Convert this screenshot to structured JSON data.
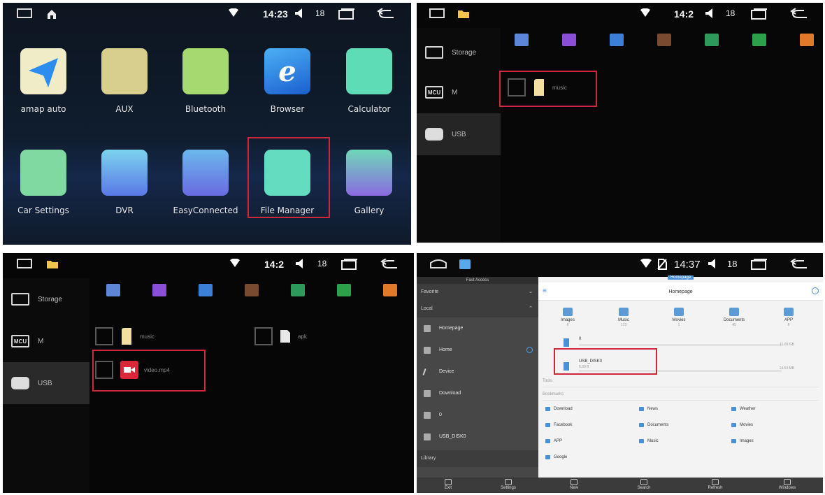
{
  "panel1": {
    "status": {
      "time": "14:23",
      "volume": "18"
    },
    "apps_row1": [
      {
        "label": "amap auto",
        "color": "#f0ecc8"
      },
      {
        "label": "AUX",
        "color": "#d8cf8e"
      },
      {
        "label": "Bluetooth",
        "color": "#a6d970"
      },
      {
        "label": "Browser",
        "color": "#2d7fd8"
      },
      {
        "label": "Calculator",
        "color": "#5ddcb6"
      }
    ],
    "apps_row2": [
      {
        "label": "Car Settings",
        "color": "#7fd9a0"
      },
      {
        "label": "DVR",
        "color": "#6fc1e8"
      },
      {
        "label": "EasyConnected",
        "color": "#5fa4e8"
      },
      {
        "label": "File Manager",
        "color": "#64dcc0"
      },
      {
        "label": "Gallery",
        "color": "#6fd8b8"
      }
    ]
  },
  "panel2": {
    "status": {
      "time": "14:2",
      "volume": "18"
    },
    "sidebar": [
      {
        "icon_label": "",
        "label": "Storage"
      },
      {
        "icon_label": "MCU",
        "label": "M"
      },
      {
        "icon_label": "",
        "label": "USB"
      }
    ],
    "categories": [
      {
        "name": "grid-icon",
        "color": "#5d86d8"
      },
      {
        "name": "image-icon",
        "color": "#8a4fd6"
      },
      {
        "name": "music-icon",
        "color": "#3c7fd6"
      },
      {
        "name": "video-icon",
        "color": "#7a4a2f"
      },
      {
        "name": "apk-icon",
        "color": "#2e9a5a"
      },
      {
        "name": "doc-icon",
        "color": "#2da04a"
      },
      {
        "name": "zip-icon",
        "color": "#e07a2a"
      }
    ],
    "file": "music"
  },
  "panel3": {
    "status": {
      "time": "14:2",
      "volume": "18"
    },
    "sidebar": [
      {
        "icon_label": "",
        "label": "Storage"
      },
      {
        "icon_label": "MCU",
        "label": "M"
      },
      {
        "icon_label": "",
        "label": "USB"
      }
    ],
    "files": [
      "music",
      "video.mp4",
      "apk"
    ]
  },
  "panel4": {
    "status": {
      "time": "14:37",
      "volume": "18"
    },
    "left_header": "Fast Access",
    "favorite": "Favorite",
    "local": "Local",
    "local_items": [
      "Homepage",
      "Home",
      "Device",
      "Download",
      "0",
      "USB_DISK0"
    ],
    "library": "Library",
    "tab": "Homepage",
    "title": "Homepage",
    "quick": [
      {
        "label": "Images",
        "count": "6"
      },
      {
        "label": "Music",
        "count": "173"
      },
      {
        "label": "Movies",
        "count": "1"
      },
      {
        "label": "Documents",
        "count": "45"
      },
      {
        "label": "APP",
        "count": "8"
      }
    ],
    "storage": [
      {
        "name": "0",
        "size": "11.65 GB"
      },
      {
        "name": "USB_DISK0",
        "free": "5.30 B",
        "size": "14.53 MB"
      }
    ],
    "tools": "Tools",
    "bookmarks": "Bookmarks",
    "bookmark_items": [
      "Download",
      "News",
      "Weather",
      "Facebook",
      "Documents",
      "Movies",
      "APP",
      "Music",
      "Images",
      "Google"
    ],
    "toolbar": [
      "Exit",
      "Settings",
      "New",
      "Search",
      "Refresh",
      "Windows"
    ]
  }
}
